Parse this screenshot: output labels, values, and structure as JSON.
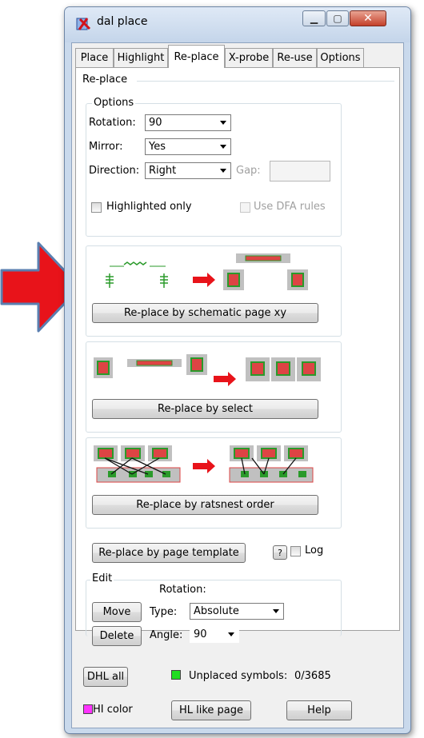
{
  "window": {
    "title": "dal place"
  },
  "tabs": [
    {
      "label": "Place"
    },
    {
      "label": "Highlight"
    },
    {
      "label": "Re-place"
    },
    {
      "label": "X-probe"
    },
    {
      "label": "Re-use"
    },
    {
      "label": "Options"
    }
  ],
  "active_tab": "Re-place",
  "replace_group": {
    "legend": "Re-place"
  },
  "options": {
    "legend": "Options",
    "rotation_label": "Rotation:",
    "rotation_value": "90",
    "mirror_label": "Mirror:",
    "mirror_value": "Yes",
    "direction_label": "Direction:",
    "direction_value": "Right",
    "gap_label": "Gap:",
    "gap_value": "",
    "highlighted_only_label": "Highlighted only",
    "use_dfa_label": "Use DFA rules"
  },
  "actions": {
    "schematic_xy": "Re-place by schematic page xy",
    "select": "Re-place by select",
    "ratsnest": "Re-place by ratsnest order",
    "page_template": "Re-place by page template",
    "help_mark": "?",
    "log_label": "Log"
  },
  "edit": {
    "legend": "Edit",
    "rotation_header": "Rotation:",
    "move": "Move",
    "delete": "Delete",
    "type_label": "Type:",
    "type_value": "Absolute",
    "angle_label": "Angle:",
    "angle_value": "90"
  },
  "bottom": {
    "dhl_all": "DHL all",
    "unplaced_label": "Unplaced symbols:",
    "unplaced_value": "0/3685",
    "hi_color": "HI color",
    "hl_like_page": "HL like page",
    "help": "Help"
  },
  "colors": {
    "arrow_red": "#e8131a",
    "arrow_outline": "#5a7fb0",
    "unplaced_swatch": "#22dd22",
    "hi_color_swatch": "#ff33ff"
  }
}
